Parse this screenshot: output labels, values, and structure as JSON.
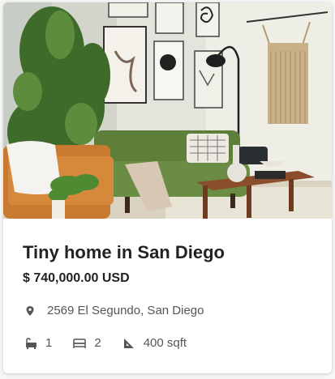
{
  "listing": {
    "title": "Tiny home in San Diego",
    "price": "$ 740,000.00 USD",
    "address": "2569 El Segundo, San Diego",
    "bathrooms": "1",
    "bedrooms": "2",
    "area": "400 sqft"
  },
  "icons": {
    "location": "location-pin-icon",
    "bath": "bathtub-icon",
    "bed": "bed-icon",
    "area": "area-ruler-icon"
  },
  "colors": {
    "title_text": "#222222",
    "secondary_text": "#555555",
    "sofa_green": "#5e7f3a"
  }
}
